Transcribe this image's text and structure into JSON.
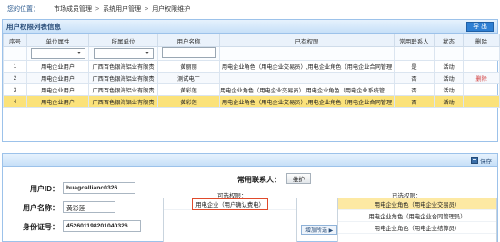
{
  "breadcrumb": {
    "lead": "您的位置：",
    "items": [
      "市场成员管理",
      "系统用户管理",
      "用户权限维护"
    ],
    "sep": ">"
  },
  "list_panel": {
    "title": "用户权限列表信息",
    "export_label": "导 出",
    "columns": [
      "序号",
      "单位属性",
      "所属单位",
      "用户名称",
      "已有权限",
      "常用联系人",
      "状态",
      "删除"
    ],
    "rows": [
      {
        "no": "1",
        "attr": "用电企业用户",
        "unit": "广西百色银海铝业有限责",
        "name": "黄丽丽",
        "perm": "用电企业角色（用电企业交易员）,用电企业角色（用电企业合同管理",
        "contact": "是",
        "status": "活动",
        "del": ""
      },
      {
        "no": "2",
        "attr": "用电企业用户",
        "unit": "广西百色银海铝业有限责",
        "name": "测试电厂",
        "perm": "",
        "contact": "否",
        "status": "活动",
        "del": "删除"
      },
      {
        "no": "3",
        "attr": "用电企业用户",
        "unit": "广西百色银海铝业有限责",
        "name": "黄彩莲",
        "perm": "用电企业角色（用电企业交易员）,用电企业角色（用电企业系统管理员）,用电企业角色（用电企业",
        "contact": "否",
        "status": "活动",
        "del": ""
      },
      {
        "no": "4",
        "attr": "用电企业用户",
        "unit": "广西百色银海铝业有限责",
        "name": "黄彩莲",
        "perm": "用电企业角色（用电企业交易员）,用电企业角色（用电企业合同管理",
        "contact": "否",
        "status": "活动",
        "del": ""
      }
    ]
  },
  "detail_panel": {
    "save_label": "保存",
    "user_id_label": "用户ID：",
    "user_id_value": "huagcallianc0326",
    "user_name_label": "用户名称：",
    "user_name_value": "黄彩莲",
    "id_card_label": "身份证号：",
    "id_card_value": "452601198201040326",
    "contact_label": "常用联系人：",
    "contact_button": "维护",
    "available_label": "可选权限：",
    "available_items": [
      "用电企业（用户确认费电）"
    ],
    "selected_label": "已选权限：",
    "selected_items": [
      "用电企业角色（用电企业交易员）",
      "用电企业角色（用电企业合同管理员）",
      "用电企业角色（用电企业结算员）"
    ],
    "add_button": "增加所选 ▶"
  },
  "colors": {
    "header_bg": "#c7e0f8",
    "selected_row": "#fbe27a",
    "export_button": "#2e7fd3"
  }
}
